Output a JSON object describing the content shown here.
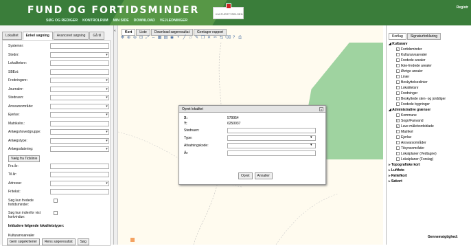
{
  "header": {
    "brand": "FUND OG FORTIDSMINDER",
    "nav": [
      "SØG OG REDIGER",
      "KONTROLRUM",
      "MIN SIDE",
      "DOWNLOAD",
      "VEJLEDNINGER"
    ],
    "logo_text": "KULTURSTYRELSEN",
    "register": "Registr"
  },
  "left_panel": {
    "tabs": [
      "Lokalitet",
      "Enkel søgning",
      "Avanceret søgning",
      "Gå til"
    ],
    "active_tab": "Enkel søgning",
    "fields": [
      {
        "label": "Systemnr:",
        "dropdown": false
      },
      {
        "label": "Stednr:",
        "dropdown": true
      },
      {
        "label": "Lokalitetsnr:",
        "dropdown": false
      },
      {
        "label": "SBExt:",
        "dropdown": false
      },
      {
        "label": "Fredningsnr.:",
        "dropdown": true
      },
      {
        "label": "Journalnr:",
        "dropdown": true
      },
      {
        "label": "Stednavn:",
        "dropdown": true
      },
      {
        "label": "Ansvarsområde:",
        "dropdown": true
      },
      {
        "label": "Ejerlav:",
        "dropdown": true
      },
      {
        "label": "Matrikelnr.:",
        "dropdown": false
      },
      {
        "label": "Anlægshovedgruppe:",
        "dropdown": true
      },
      {
        "label": "Anlægstype:",
        "dropdown": true
      },
      {
        "label": "Anlægsdatering:",
        "dropdown": true
      }
    ],
    "tidslinie_button": "Vælg fra Tidslinie",
    "fields2": [
      {
        "label": "Fra år:",
        "dropdown": false
      },
      {
        "label": "Til år:",
        "dropdown": false
      },
      {
        "label": "Adresse:",
        "dropdown": true
      },
      {
        "label": "Fritekst:",
        "dropdown": false
      }
    ],
    "checkbox1": "Søg kun fredede fortidsminder:",
    "checkbox2": "Søg kun indenfor vist kortvindue:",
    "include_heading": "Inkludere følgende lokalitetstyper:",
    "kulturarv_label": "Kulturarvsarealer",
    "buttons": [
      "Gem søgekriterier",
      "Rens søgeresultat",
      "Søg"
    ]
  },
  "map": {
    "tabs": [
      "Kort",
      "Liste",
      "Download søgeresultat",
      "Gentager rapport"
    ],
    "active_tab": "Kort",
    "toolbar_icons": [
      "pan-icon",
      "zoom-in-icon",
      "zoom-out-icon",
      "zoom-box-icon",
      "zoom-extent-icon",
      "measure-icon",
      "grid-icon",
      "layers-icon",
      "globe-icon",
      "points-icon",
      "line-icon",
      "polygon-icon",
      "edit-icon",
      "copy-icon",
      "delete-icon",
      "split-icon",
      "merge-icon",
      "clear-icon",
      "identify-icon",
      "print-icon"
    ]
  },
  "dialog": {
    "title": "Opret lokalitet",
    "x_label": "X:",
    "x_value": "579954",
    "y_label": "Y:",
    "y_value": "6250037",
    "stednavn_label": "Stednavn:",
    "type_label": "Type:",
    "afvatningskode_label": "Afvatningskode:",
    "aar_label": "År:",
    "ok_button": "Opret",
    "cancel_button": "Annaller"
  },
  "right_panel": {
    "tabs": [
      "Kortlag",
      "Signaturforklaring"
    ],
    "tree": [
      {
        "label": "Kulturarv",
        "type": "group"
      },
      {
        "label": "Fortidsminder",
        "checked": true
      },
      {
        "label": "Kulturarvsarealer",
        "checked": false
      },
      {
        "label": "Fredede arealer",
        "checked": false
      },
      {
        "label": "Ikke-fredede arealer",
        "checked": false
      },
      {
        "label": "Øvrige arealer",
        "checked": false
      },
      {
        "label": "Linier",
        "checked": false
      },
      {
        "label": "Beskyttelseslinier",
        "checked": false
      },
      {
        "label": "Lokalitetsnr",
        "checked": false
      },
      {
        "label": "Fredninger",
        "checked": false
      },
      {
        "label": "Beskyttede sten- og jorddiger",
        "checked": false
      },
      {
        "label": "Fredede bygninger",
        "checked": false
      },
      {
        "label": "Administrative grænser",
        "type": "group"
      },
      {
        "label": "Kommune",
        "checked": false
      },
      {
        "label": "Sogn/Fanvand",
        "checked": true
      },
      {
        "label": "Lave målebordsblade",
        "checked": true
      },
      {
        "label": "Matrikel",
        "checked": false
      },
      {
        "label": "Ejerlav",
        "checked": false
      },
      {
        "label": "Ansvarsområder",
        "checked": false
      },
      {
        "label": "Tilsynsområder",
        "checked": false
      },
      {
        "label": "Lokalplaner (Vedtagne)",
        "checked": false
      },
      {
        "label": "Lokalplaner (Forslag)",
        "checked": false
      },
      {
        "label": "Topografiske kort",
        "type": "collapsed"
      },
      {
        "label": "Luftfoto",
        "type": "collapsed"
      },
      {
        "label": "Reliefkort",
        "type": "collapsed"
      },
      {
        "label": "Søkort",
        "type": "collapsed"
      }
    ],
    "footer": "Gennemsigtighed:"
  },
  "colors": {
    "header_green": "#3a7d3a",
    "map_area": "#9fd3a0",
    "map_bg": "#fffbef"
  }
}
